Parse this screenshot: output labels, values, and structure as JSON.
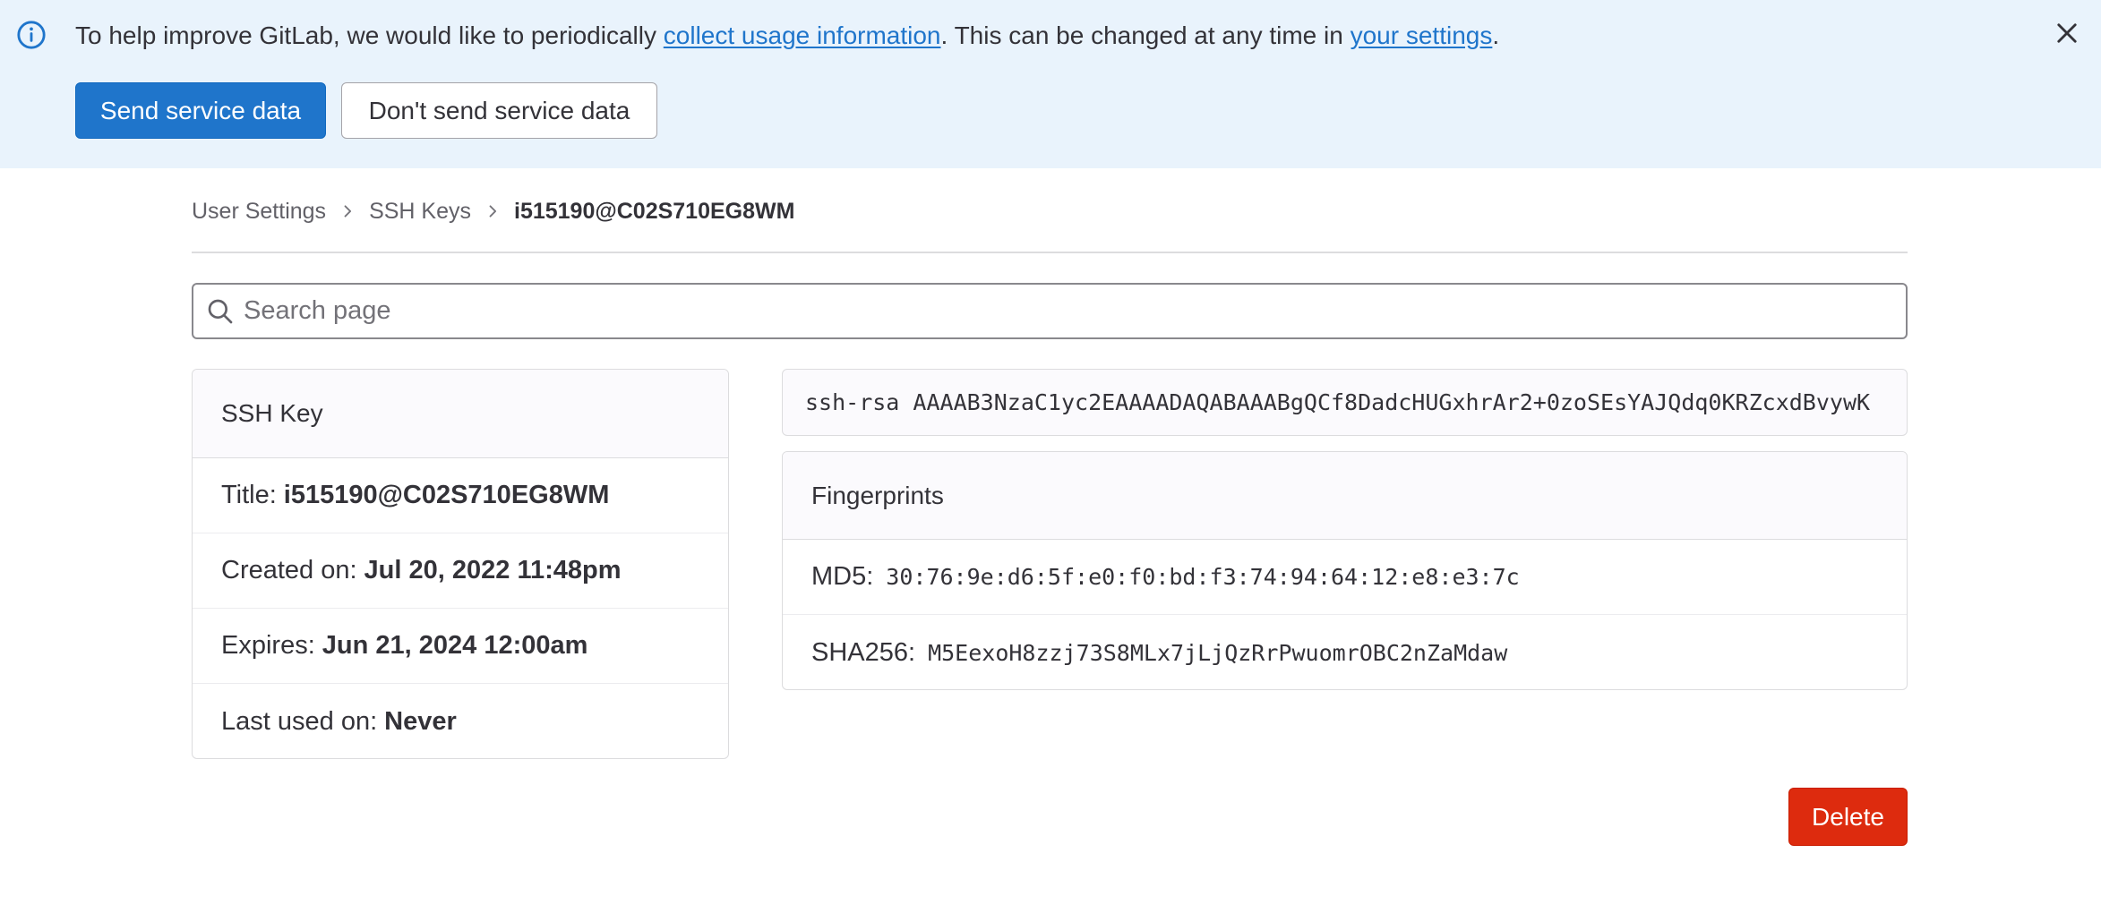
{
  "banner": {
    "text_before": "To help improve GitLab, we would like to periodically ",
    "link1": "collect usage information",
    "text_middle": ". This can be changed at any time in ",
    "link2": "your settings",
    "text_after": ".",
    "send_label": "Send service data",
    "dont_send_label": "Don't send service data",
    "icons": {
      "info": "info-icon",
      "close": "close-icon"
    }
  },
  "breadcrumb": {
    "items": [
      "User Settings",
      "SSH Keys",
      "i515190@C02S710EG8WM"
    ]
  },
  "search": {
    "placeholder": "Search page",
    "value": ""
  },
  "ssh_key_card": {
    "header": "SSH Key",
    "title_label": "Title:",
    "title_value": "i515190@C02S710EG8WM",
    "created_label": "Created on:",
    "created_value": "Jul 20, 2022 11:48pm",
    "expires_label": "Expires:",
    "expires_value": "Jun 21, 2024 12:00am",
    "last_used_label": "Last used on:",
    "last_used_value": "Never"
  },
  "key_text": "ssh-rsa AAAAB3NzaC1yc2EAAAADAQABAAABgQCf8DadcHUGxhrAr2+0zoSEsYAJQdq0KRZcxdBvywK",
  "fingerprints": {
    "header": "Fingerprints",
    "md5_label": "MD5:",
    "md5_value": "30:76:9e:d6:5f:e0:f0:bd:f3:74:94:64:12:e8:e3:7c",
    "sha256_label": "SHA256:",
    "sha256_value": "M5EexoH8zzj73S8MLx7jLjQzRrPwuomrOBC2nZaMdaw"
  },
  "delete_label": "Delete",
  "colors": {
    "accent": "#1f75cb",
    "danger": "#dd2b0e",
    "banner_bg": "#e9f3fc"
  }
}
